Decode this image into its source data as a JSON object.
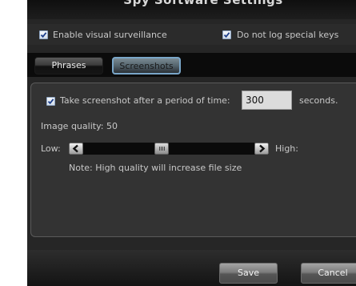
{
  "window": {
    "title": "Spy Software Settings"
  },
  "options": {
    "enable_visual_surveillance": {
      "label": "Enable visual surveillance",
      "checked": true
    },
    "do_not_log_special_keys": {
      "label": "Do not log special keys",
      "checked": true
    }
  },
  "tabs": [
    {
      "label": "Phrases",
      "active": false
    },
    {
      "label": "Screenshots",
      "active": true
    }
  ],
  "screenshots": {
    "take_screenshot": {
      "label": "Take screenshot after a period of time:",
      "checked": true
    },
    "interval_value": "300",
    "interval_unit": "seconds.",
    "image_quality_label": "Image quality: 50",
    "image_quality_value": 50,
    "slider_low_label": "Low:",
    "slider_high_label": "High:",
    "note": "Note: High quality will increase file size"
  },
  "buttons": {
    "save": "Save",
    "cancel": "Cancel"
  },
  "colors": {
    "window_bg": "#262626",
    "panel_bg": "#333333",
    "active_tab_border": "#7aa6c8",
    "checkbox_check": "#1c3f8c"
  },
  "icons": {
    "slider_left": "chevron-left-icon",
    "slider_right": "chevron-right-icon",
    "check": "checkmark-icon"
  }
}
